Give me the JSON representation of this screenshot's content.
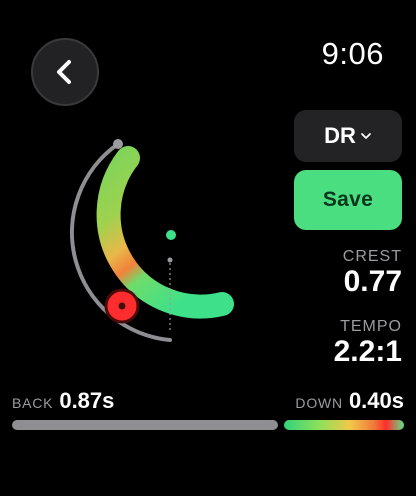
{
  "header": {
    "time": "9:06",
    "back_icon": "chevron-left-icon"
  },
  "controls": {
    "mode_label": "DR",
    "mode_icon": "chevron-down-icon",
    "save_label": "Save"
  },
  "stats": {
    "crest_label": "CREST",
    "crest_value": "0.77",
    "tempo_label": "TEMPO",
    "tempo_value": "2.2:1"
  },
  "phases": {
    "back_label": "BACK",
    "back_value": "0.87s",
    "down_label": "DOWN",
    "down_value": "0.40s"
  },
  "colors": {
    "accent_green": "#4ade80",
    "alert_red": "#ff2d2d",
    "track_gray": "#8e8e93"
  }
}
